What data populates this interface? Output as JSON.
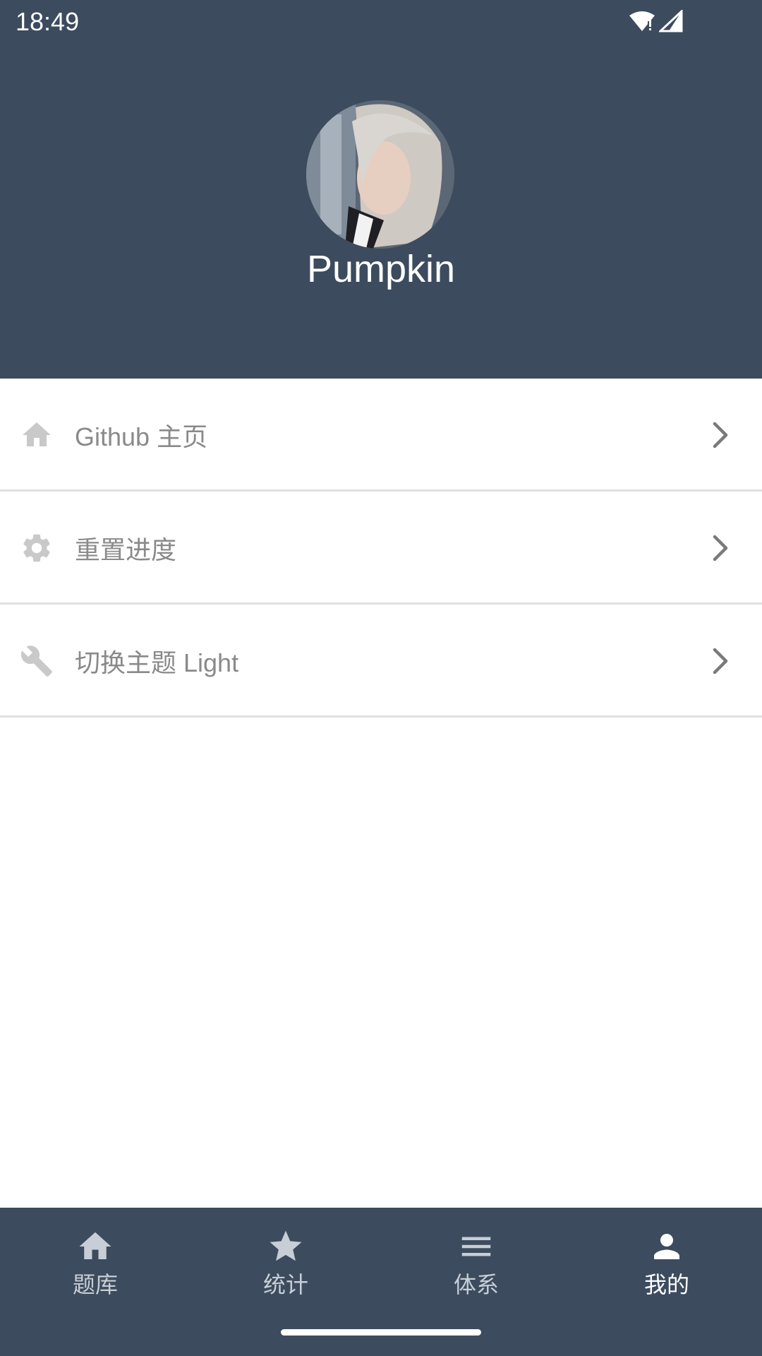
{
  "status_bar": {
    "time": "18:49",
    "wifi_icon": "wifi-icon",
    "signal_icon": "signal-icon"
  },
  "profile": {
    "name": "Pumpkin",
    "avatar": "avatar-image"
  },
  "menu": [
    {
      "label": "Github 主页",
      "icon": "home-icon"
    },
    {
      "label": "重置进度",
      "icon": "gear-icon"
    },
    {
      "label": "切换主题 Light",
      "icon": "wrench-icon"
    }
  ],
  "bottom_nav": [
    {
      "label": "题库",
      "icon": "home-icon",
      "active": false
    },
    {
      "label": "统计",
      "icon": "star-icon",
      "active": false
    },
    {
      "label": "体系",
      "icon": "menu-icon",
      "active": false
    },
    {
      "label": "我的",
      "icon": "person-icon",
      "active": true
    }
  ],
  "colors": {
    "header_bg": "#3c4b5e",
    "nav_bg": "#3c4b5e",
    "menu_text": "#8a8a8a",
    "icon_gray": "#c9c9c9"
  }
}
